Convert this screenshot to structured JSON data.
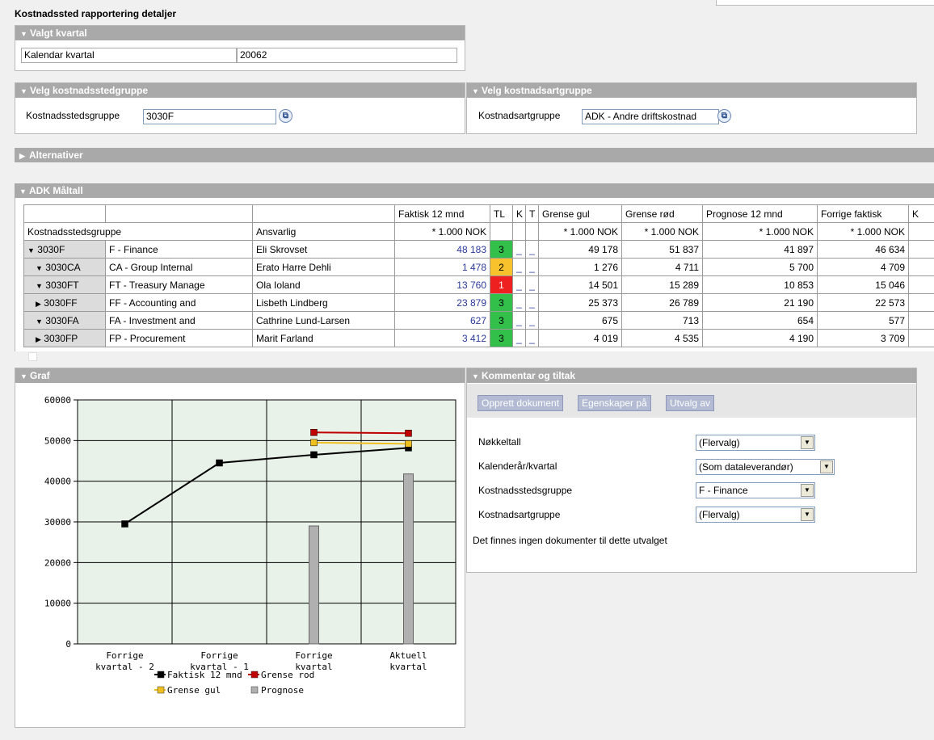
{
  "page_title": "Kostnadssted rapportering detaljer",
  "valgt_kvartal": {
    "header": "Valgt kvartal",
    "label": "Kalendar kvartal",
    "value": "20062"
  },
  "velg_kostnadsstedgruppe": {
    "header": "Velg kostnadsstedgruppe",
    "label": "Kostnadsstedsgruppe",
    "value": "3030F"
  },
  "velg_kostnadsartgruppe": {
    "header": "Velg kostnadsartgruppe",
    "label": "Kostnadsartgruppe",
    "value": "ADK - Andre driftskostnad"
  },
  "alternativer": {
    "header": "Alternativer"
  },
  "maltall": {
    "header": "ADK Måltall",
    "top_headers": [
      "Faktisk 12 mnd",
      "TL",
      "K",
      "T",
      "Grense gul",
      "Grense rød",
      "Prognose 12 mnd",
      "Forrige faktisk",
      "K"
    ],
    "col_headers": {
      "group": "Kostnadsstedsgruppe",
      "responsible": "Ansvarlig",
      "unit": "* 1.000 NOK"
    },
    "rows": [
      {
        "code": "3030F",
        "name": "F - Finance",
        "resp": "Eli Skrovset",
        "faktisk": "48 183",
        "tl": "3",
        "status": "green",
        "gul": "49 178",
        "rod": "51 837",
        "prognose": "41 897",
        "forrige": "46 634",
        "expand": "▼"
      },
      {
        "code": "3030CA",
        "name": "CA - Group Internal",
        "resp": "Erato Harre Dehli",
        "faktisk": "1 478",
        "tl": "2",
        "status": "yellow",
        "gul": "1 276",
        "rod": "4 711",
        "prognose": "5 700",
        "forrige": "4 709",
        "expand": "▼"
      },
      {
        "code": "3030FT",
        "name": "FT - Treasury Manage",
        "resp": "Ola Ioland",
        "faktisk": "13 760",
        "tl": "1",
        "status": "red",
        "gul": "14 501",
        "rod": "15 289",
        "prognose": "10 853",
        "forrige": "15 046",
        "expand": "▼"
      },
      {
        "code": "3030FF",
        "name": "FF - Accounting and",
        "resp": "Lisbeth Lindberg",
        "faktisk": "23 879",
        "tl": "3",
        "status": "green",
        "gul": "25 373",
        "rod": "26 789",
        "prognose": "21 190",
        "forrige": "22 573",
        "expand": "▶"
      },
      {
        "code": "3030FA",
        "name": "FA - Investment and",
        "resp": "Cathrine Lund-Larsen",
        "faktisk": "627",
        "tl": "3",
        "status": "green",
        "gul": "675",
        "rod": "713",
        "prognose": "654",
        "forrige": "577",
        "expand": "▼"
      },
      {
        "code": "3030FP",
        "name": "FP - Procurement",
        "resp": "Marit Farland",
        "faktisk": "3 412",
        "tl": "3",
        "status": "green",
        "gul": "4 019",
        "rod": "4 535",
        "prognose": "4 190",
        "forrige": "3 709",
        "expand": "▶"
      }
    ],
    "dash": "_"
  },
  "graf": {
    "header": "Graf",
    "legend": {
      "faktisk": "Faktisk 12 mnd",
      "rod": "Grense rod",
      "gul": "Grense gul",
      "prognose": "Prognose"
    },
    "xlabels": [
      [
        "Forrige",
        "kvartal - 2"
      ],
      [
        "Forrige",
        "kvartal - 1"
      ],
      [
        "Forrige",
        "kvartal"
      ],
      [
        "Aktuell",
        "kvartal"
      ]
    ],
    "ylabels": [
      "60000",
      "50000",
      "40000",
      "30000",
      "20000",
      "10000",
      "0"
    ]
  },
  "chart_data": {
    "type": "line",
    "categories": [
      "Forrige kvartal - 2",
      "Forrige kvartal - 1",
      "Forrige kvartal",
      "Aktuell kvartal"
    ],
    "ylim": [
      0,
      60000
    ],
    "series": [
      {
        "name": "Faktisk 12 mnd",
        "type": "line",
        "color": "#000000",
        "values": [
          29500,
          44500,
          46500,
          48200
        ]
      },
      {
        "name": "Grense rod",
        "type": "line",
        "color": "#c00000",
        "values": [
          null,
          null,
          52000,
          51800
        ]
      },
      {
        "name": "Grense gul",
        "type": "line",
        "color": "#f0c020",
        "values": [
          null,
          null,
          49500,
          49200
        ]
      },
      {
        "name": "Prognose",
        "type": "bar",
        "color": "#b0b0b0",
        "values": [
          null,
          null,
          29000,
          41800
        ]
      }
    ],
    "grid": true,
    "legend": "bottom"
  },
  "kommentar": {
    "header": "Kommentar og tiltak",
    "buttons": [
      "Opprett dokument",
      "Egenskaper på",
      "Utvalg av"
    ],
    "filters": [
      {
        "label": "Nøkkeltall",
        "value": "(Flervalg)"
      },
      {
        "label": "Kalenderår/kvartal",
        "value": "(Som dataleverandør)"
      },
      {
        "label": "Kostnadsstedsgruppe",
        "value": "F - Finance"
      },
      {
        "label": "Kostnadsartgruppe",
        "value": "(Flervalg)"
      }
    ],
    "empty_text": "Det finnes ingen dokumenter til dette utvalget"
  },
  "colors": {
    "header_bg": "#a9a9a9",
    "green": "#32c04a",
    "yellow": "#f7c22b",
    "red": "#ee2020",
    "chart_bg": "#e8f2e8"
  }
}
